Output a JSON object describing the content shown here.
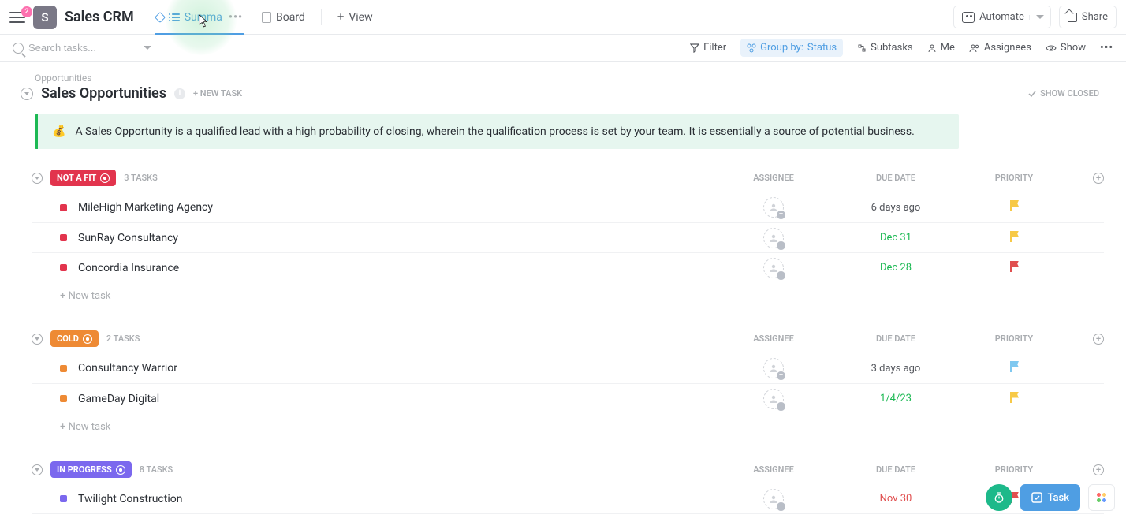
{
  "header": {
    "menu_badge": "2",
    "space_initial": "S",
    "space_title": "Sales CRM",
    "tabs": [
      {
        "label": "Summa",
        "icon": "list",
        "active": true
      },
      {
        "label": "Board",
        "icon": "board",
        "active": false
      }
    ],
    "add_view_label": "View",
    "automate_label": "Automate",
    "share_label": "Share"
  },
  "toolbar": {
    "search_placeholder": "Search tasks...",
    "filter_label": "Filter",
    "groupby_label": "Group by:",
    "groupby_value": "Status",
    "subtasks_label": "Subtasks",
    "me_label": "Me",
    "assignees_label": "Assignees",
    "show_label": "Show"
  },
  "list": {
    "breadcrumb": "Opportunities",
    "title": "Sales Opportunities",
    "new_task_label": "+ NEW TASK",
    "show_closed_label": "SHOW CLOSED",
    "callout_emoji": "💰",
    "callout_text": "A Sales Opportunity is a qualified lead with a high probability of closing, wherein the qualification process is set by your team. It is essentially a source of potential business."
  },
  "columns": {
    "assignee": "ASSIGNEE",
    "due": "DUE DATE",
    "priority": "PRIORITY"
  },
  "new_task_row_label": "+ New task",
  "groups": [
    {
      "status": "NOT A FIT",
      "color": "#e2344d",
      "count_label": "3 TASKS",
      "tasks": [
        {
          "name": "MileHigh Marketing Agency",
          "due": "6 days ago",
          "due_style": "past",
          "priority": "yellow"
        },
        {
          "name": "SunRay Consultancy",
          "due": "Dec 31",
          "due_style": "green",
          "priority": "yellow"
        },
        {
          "name": "Concordia Insurance",
          "due": "Dec 28",
          "due_style": "green",
          "priority": "red"
        }
      ]
    },
    {
      "status": "COLD",
      "color": "#ee8a34",
      "count_label": "2 TASKS",
      "tasks": [
        {
          "name": "Consultancy Warrior",
          "due": "3 days ago",
          "due_style": "past",
          "priority": "blue"
        },
        {
          "name": "GameDay Digital",
          "due": "1/4/23",
          "due_style": "green",
          "priority": "yellow"
        }
      ]
    },
    {
      "status": "IN PROGRESS",
      "color": "#7b68ee",
      "count_label": "8 TASKS",
      "tasks": [
        {
          "name": "Twilight Construction",
          "due": "Nov 30",
          "due_style": "red",
          "priority": "red"
        }
      ]
    }
  ],
  "fab": {
    "task_label": "Task"
  }
}
